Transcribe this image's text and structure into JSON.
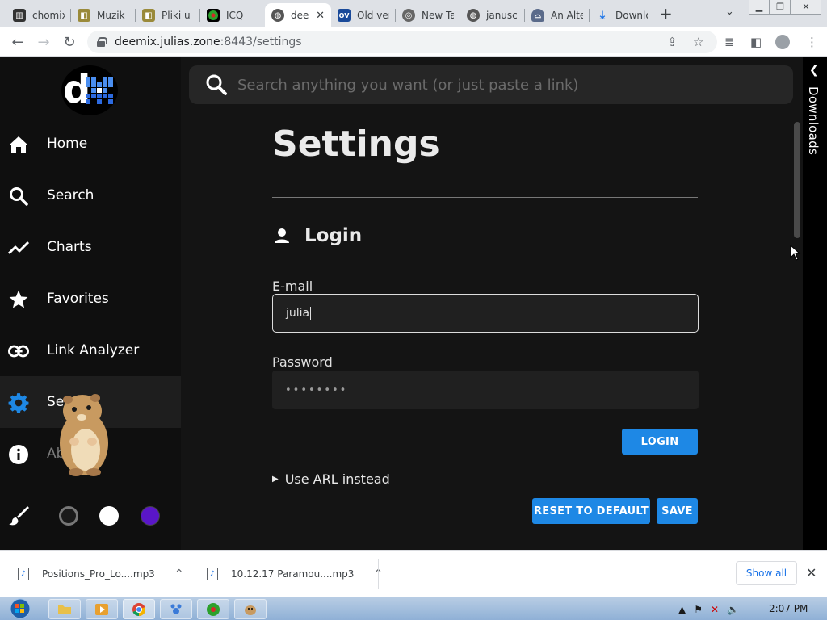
{
  "browser": {
    "tabs": [
      {
        "title": "chomix",
        "icon": "library-icon",
        "color": "#333333"
      },
      {
        "title": "Muzik",
        "icon": "folder-icon",
        "color": "#8a7a2a"
      },
      {
        "title": "Pliki u",
        "icon": "folder-icon",
        "color": "#8a7a2a"
      },
      {
        "title": "ICQ",
        "icon": "icq-flower-icon",
        "color": "#2a9a2a"
      },
      {
        "title": "dee",
        "icon": "globe-icon",
        "color": "#555555"
      },
      {
        "title": "Old ver",
        "icon": "oldversion-icon",
        "color": "#1a4a9a"
      },
      {
        "title": "New Ta",
        "icon": "chrome-icon",
        "color": "#666666"
      },
      {
        "title": "januscy",
        "icon": "globe-icon",
        "color": "#555555"
      },
      {
        "title": "An Alte",
        "icon": "ufo-icon",
        "color": "#5a6a8a"
      },
      {
        "title": "Downlo",
        "icon": "download-icon",
        "color": "#1a73e8"
      }
    ],
    "active_tab_index": 4,
    "url_host": "deemix.julias.zone",
    "url_rest": ":8443/settings"
  },
  "app": {
    "search_placeholder": "Search anything you want (or just paste a link)",
    "downloads_label": "Downloads",
    "nav": [
      {
        "label": "Home",
        "icon": "home-icon"
      },
      {
        "label": "Search",
        "icon": "search-icon"
      },
      {
        "label": "Charts",
        "icon": "chart-line-icon"
      },
      {
        "label": "Favorites",
        "icon": "star-icon"
      },
      {
        "label": "Link Analyzer",
        "icon": "link-icon"
      },
      {
        "label": "Set",
        "icon": "gear-icon"
      },
      {
        "label": "Ab",
        "icon": "info-icon"
      }
    ],
    "theme_swatches": [
      "#1a1a1a",
      "#ffffff",
      "#5a16c8"
    ],
    "settings": {
      "title": "Settings",
      "section": "Login",
      "email_label": "E-mail",
      "email_value": "julia",
      "password_label": "Password",
      "password_value": "••••••••",
      "login_button": "LOGIN",
      "arl_toggle": "Use ARL instead",
      "reset_button": "RESET TO DEFAULT",
      "save_button": "SAVE"
    }
  },
  "downloads_shelf": {
    "items": [
      "Positions_Pro_Lo....mp3",
      "10.12.17 Paramou....mp3"
    ],
    "show_all": "Show all"
  },
  "taskbar": {
    "clock": "2:07 PM"
  },
  "colors": {
    "accent": "#1e88e5",
    "app_bg": "#141414",
    "sidebar_bg": "#0f0f0f",
    "active_nav_icon": "#1e88e5"
  }
}
